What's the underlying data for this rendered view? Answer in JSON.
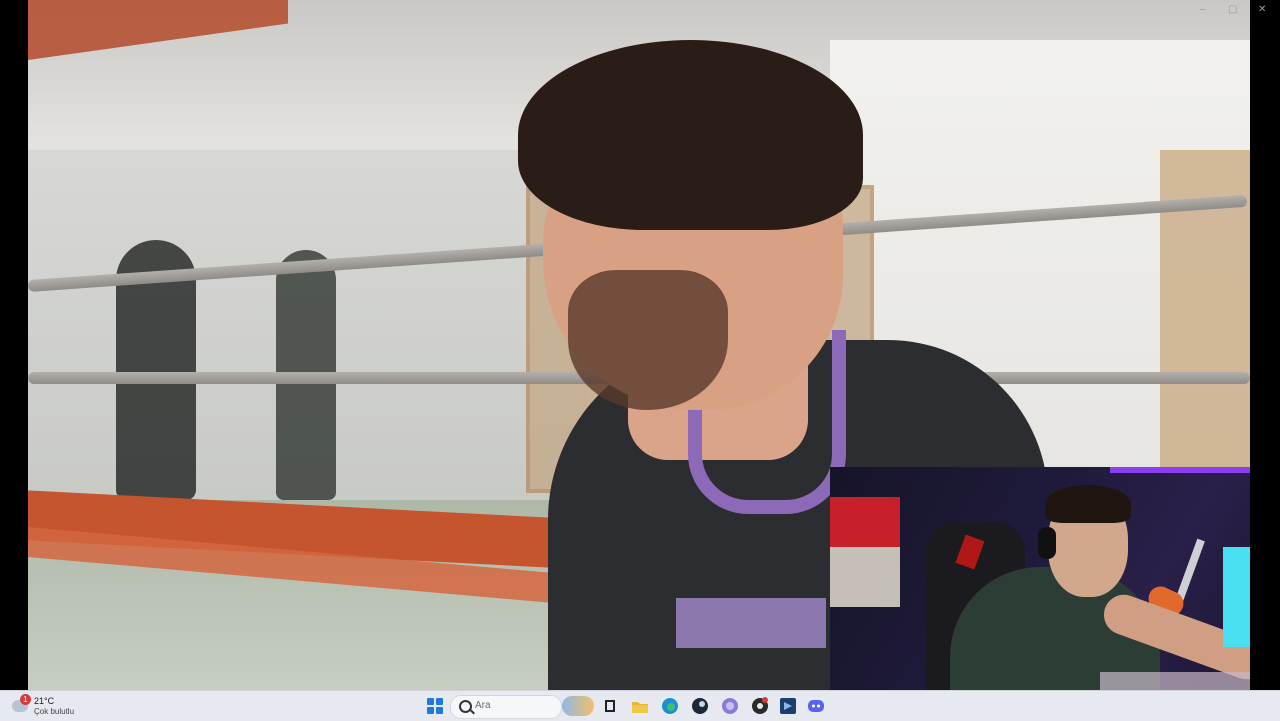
{
  "taskbar": {
    "weather": {
      "temperature": "21°C",
      "condition": "Çok bulutlu",
      "badge_count": "1"
    },
    "search": {
      "placeholder": "Ara"
    },
    "icons": [
      {
        "name": "start-icon"
      },
      {
        "name": "widgets-icon"
      },
      {
        "name": "task-view-icon"
      },
      {
        "name": "file-explorer-icon",
        "color": "#e8b53a"
      },
      {
        "name": "edge-icon",
        "color": "#1a8fd6"
      },
      {
        "name": "steam-icon",
        "color": "#1b2838"
      },
      {
        "name": "app-purple-icon",
        "color": "#8a7bd6"
      },
      {
        "name": "obs-icon",
        "color": "#2a2a2a"
      },
      {
        "name": "visual-studio-icon",
        "color": "#1a3e6e"
      },
      {
        "name": "discord-icon",
        "color": "#5865f2"
      }
    ]
  },
  "colors": {
    "taskbar_bg": "#e6e9ef",
    "badge": "#d83b3b",
    "shirt_accent": "#8c6ab8"
  }
}
